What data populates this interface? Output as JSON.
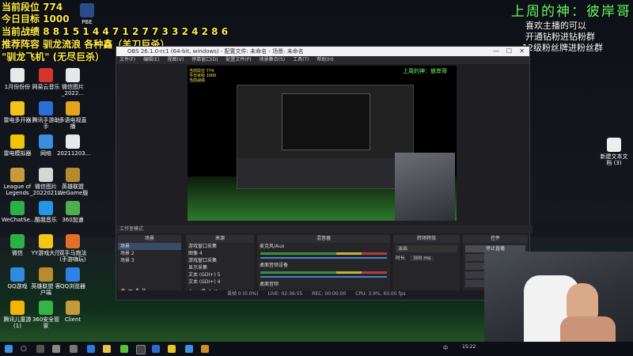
{
  "overlay": {
    "rank_line": "当前段位 774",
    "goal_line": "今日目标 1000",
    "record_label": "当前战绩",
    "record_digits": "8 8 1 5 1 4 4 7 1 2 7 7 3 3 2 4 2 8 6",
    "recommend_line": "推荐阵容 驯龙流浪 各种鑫（羊刀巨杀）",
    "flyer_line": "\"驯龙飞机\" (无尽巨杀）",
    "god_line": "上周的神：彼岸哥",
    "note1": "喜欢主播的可以",
    "note2": "开通钻粉进钻粉群",
    "note3": "12级粉丝牌进粉丝群"
  },
  "desktop_icons": [
    {
      "label": "1月份份份",
      "color": "#e9e9e9"
    },
    {
      "label": "网易云音乐",
      "color": "#d8342b"
    },
    {
      "label": "微信图片_2022...",
      "color": "#e7e7e7"
    },
    {
      "label": "雷电多开器",
      "color": "#f2c21a"
    },
    {
      "label": "腾讯手游助手",
      "color": "#2b6fd6"
    },
    {
      "label": "多语电视直播",
      "color": "#e2a321"
    },
    {
      "label": "雷电模拟器",
      "color": "#f0c400"
    },
    {
      "label": "网络",
      "color": "#3a8fe0"
    },
    {
      "label": "20211203...",
      "color": "#e8e8e8"
    },
    {
      "label": "League of Legends",
      "color": "#c79a3c"
    },
    {
      "label": "微信图片_2022021...",
      "color": "#d6d6d6"
    },
    {
      "label": "英雄联盟 WeGame版",
      "color": "#b58b2e"
    },
    {
      "label": "WeChatSe...",
      "color": "#2ab24a"
    },
    {
      "label": "酷我音乐",
      "color": "#2596e8"
    },
    {
      "label": "360加速",
      "color": "#4cb14c"
    },
    {
      "label": "微信",
      "color": "#2ab24a"
    },
    {
      "label": "YY游戏大厅",
      "color": "#f5c518"
    },
    {
      "label": "双手马炮法 (手游嗨玩)",
      "color": "#e46f2a"
    },
    {
      "label": "QQ游戏",
      "color": "#2f8be0"
    },
    {
      "label": "英雄联盟 客户端",
      "color": "#b88b30"
    },
    {
      "label": "QQ浏览器",
      "color": "#2e82e6"
    },
    {
      "label": "腾讯儿童游 (1)",
      "color": "#f4b400"
    },
    {
      "label": "360安全管家",
      "color": "#36b24a"
    },
    {
      "label": "Client",
      "color": "#c39a3a"
    }
  ],
  "right_icons": [
    {
      "label": "新建文本文档 (3)"
    },
    {
      "label": "PBE"
    }
  ],
  "obs": {
    "title": "OBS 26.1.0-rc1 (64-bit, windows) - 配置文件: 未命名 - 场景: 未命名",
    "menu": [
      "文件(F)",
      "编辑(E)",
      "视图(V)",
      "停靠窗口(D)",
      "配置文件(P)",
      "场景集合(S)",
      "工具(T)",
      "帮助(H)"
    ],
    "studio_mode_label": "工作室模式",
    "scenes_header": "场景",
    "scenes": [
      "场景",
      "场景 2",
      "场景 3"
    ],
    "sources_header": "来源",
    "sources": [
      "游戏窗口采集",
      "图像 4",
      "游戏窗口采集",
      "显示采集",
      "文本 (GDI+) 5",
      "文本 (GDI+) 4"
    ],
    "mixer_header": "混音器",
    "mixer": [
      {
        "name": "麦克风/Aux",
        "db": "0.0 dB"
      },
      {
        "name": "桌面音频设备",
        "db": "-0.2 dB"
      },
      {
        "name": "桌面音频",
        "db": "0.0 dB"
      }
    ],
    "transitions_header": "转场特效",
    "transition_value": "淡出",
    "duration_label": "时长",
    "duration_value": "300 ms",
    "controls_header": "控件",
    "controls": [
      "停止直播",
      "开始录制",
      "工作室模式",
      "设置",
      "退出"
    ],
    "status": [
      "丢帧 0 (0.0%)",
      "LIVE: 02:36:55",
      "REC: 00:00:00",
      "CPU: 3.9%, 60.00 fps"
    ]
  },
  "taskbar": {
    "clock": "15:22",
    "tray_text": "中"
  }
}
